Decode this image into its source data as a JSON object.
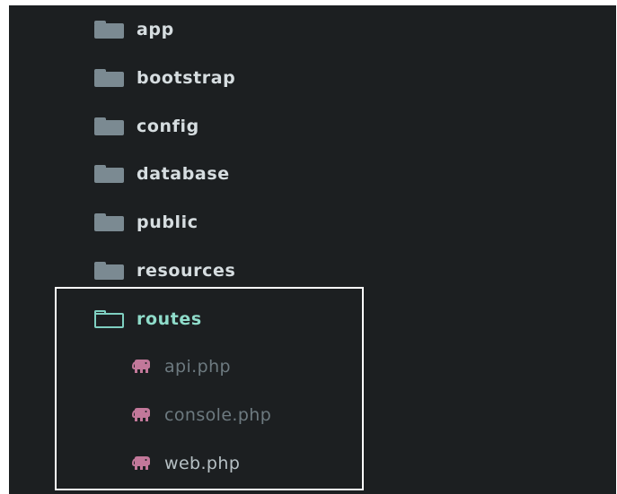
{
  "tree": {
    "folders": [
      {
        "label": "app"
      },
      {
        "label": "bootstrap"
      },
      {
        "label": "config"
      },
      {
        "label": "database"
      },
      {
        "label": "public"
      },
      {
        "label": "resources"
      }
    ],
    "expanded_folder": {
      "label": "routes",
      "icon": "folder-open-icon",
      "files": [
        {
          "label": "api.php",
          "icon": "php-elephant-icon"
        },
        {
          "label": "console.php",
          "icon": "php-elephant-icon"
        },
        {
          "label": "web.php",
          "icon": "php-elephant-icon"
        }
      ]
    }
  },
  "colors": {
    "background": "#1c1f21",
    "folder_icon": "#7b8a92",
    "active_folder": "#8fdcca",
    "php_icon": "#c2789a",
    "highlight_border": "#ffffff"
  }
}
